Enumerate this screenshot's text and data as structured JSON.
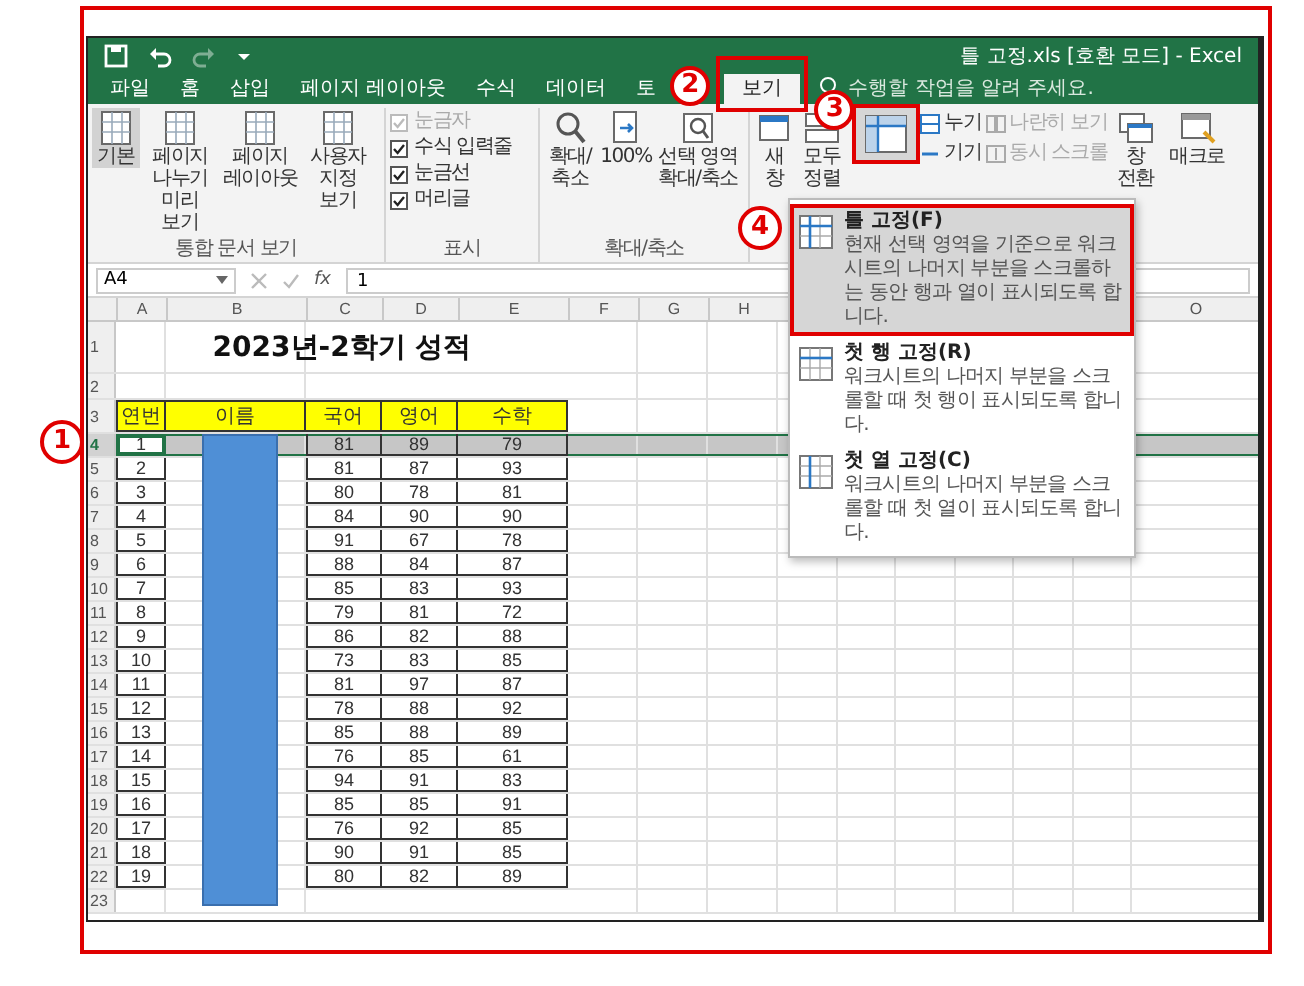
{
  "window": {
    "title": "틀 고정.xls  [호환 모드] - Excel"
  },
  "tabs": [
    {
      "label": "파일",
      "selected": false
    },
    {
      "label": "홈",
      "selected": false
    },
    {
      "label": "삽입",
      "selected": false
    },
    {
      "label": "페이지 레이아웃",
      "selected": false
    },
    {
      "label": "수식",
      "selected": false
    },
    {
      "label": "데이터",
      "selected": false
    },
    {
      "label": "토",
      "selected": false
    },
    {
      "label": "보기",
      "selected": true
    }
  ],
  "tell_me": {
    "placeholder": "수행할 작업을 알려 주세요."
  },
  "ribbon": {
    "workbook_views": {
      "label": "통합 문서 보기",
      "buttons": [
        {
          "label": "기본",
          "selected": true
        },
        {
          "label": "페이지 나누기 미리 보기",
          "selected": false
        },
        {
          "label": "페이지 레이아웃",
          "selected": false
        },
        {
          "label": "사용자 지정 보기",
          "selected": false
        }
      ]
    },
    "show": {
      "label": "표시",
      "options": [
        {
          "label": "눈금자",
          "checked": true,
          "disabled": true
        },
        {
          "label": "수식 입력줄",
          "checked": true,
          "disabled": false
        },
        {
          "label": "눈금선",
          "checked": true,
          "disabled": false
        },
        {
          "label": "머리글",
          "checked": true,
          "disabled": false
        }
      ]
    },
    "zoom": {
      "label": "확대/축소",
      "buttons": [
        "확대/축소",
        "100%",
        "선택 영역 확대/축소"
      ]
    },
    "window": {
      "new_window": "새 창",
      "arrange_all": "모두 정렬",
      "split": "누기",
      "hide": "기기",
      "side_by_side": {
        "label": "나란히 보기",
        "disabled": true
      },
      "sync_scroll": {
        "label": "동시 스크롤",
        "disabled": true
      },
      "switch_windows": "창 전환",
      "macros": "매크로"
    }
  },
  "formula_bar": {
    "name_box": "A4",
    "function_label": "fx",
    "value": "1"
  },
  "sheet": {
    "columns_left": [
      "A",
      "B",
      "C",
      "D",
      "E",
      "F",
      "G",
      "H"
    ],
    "columns_right": [
      "O"
    ],
    "title": {
      "row": "1",
      "text": "2023년-2학기 성적"
    },
    "blank_row": "2",
    "header": {
      "row": "3",
      "cells": [
        "연번",
        "이름",
        "국어",
        "영어",
        "수학"
      ]
    },
    "rows": [
      {
        "row": "4",
        "no": "1",
        "korean": "81",
        "english": "89",
        "math": "79",
        "selected": true
      },
      {
        "row": "5",
        "no": "2",
        "korean": "81",
        "english": "87",
        "math": "93",
        "selected": false
      },
      {
        "row": "6",
        "no": "3",
        "korean": "80",
        "english": "78",
        "math": "81",
        "selected": false
      },
      {
        "row": "7",
        "no": "4",
        "korean": "84",
        "english": "90",
        "math": "90",
        "selected": false
      },
      {
        "row": "8",
        "no": "5",
        "korean": "91",
        "english": "67",
        "math": "78",
        "selected": false
      },
      {
        "row": "9",
        "no": "6",
        "korean": "88",
        "english": "84",
        "math": "87",
        "selected": false
      },
      {
        "row": "10",
        "no": "7",
        "korean": "85",
        "english": "83",
        "math": "93",
        "selected": false
      },
      {
        "row": "11",
        "no": "8",
        "korean": "79",
        "english": "81",
        "math": "72",
        "selected": false
      },
      {
        "row": "12",
        "no": "9",
        "korean": "86",
        "english": "82",
        "math": "88",
        "selected": false
      },
      {
        "row": "13",
        "no": "10",
        "korean": "73",
        "english": "83",
        "math": "85",
        "selected": false
      },
      {
        "row": "14",
        "no": "11",
        "korean": "81",
        "english": "97",
        "math": "87",
        "selected": false
      },
      {
        "row": "15",
        "no": "12",
        "korean": "78",
        "english": "88",
        "math": "92",
        "selected": false
      },
      {
        "row": "16",
        "no": "13",
        "korean": "85",
        "english": "88",
        "math": "89",
        "selected": false
      },
      {
        "row": "17",
        "no": "14",
        "korean": "76",
        "english": "85",
        "math": "61",
        "selected": false
      },
      {
        "row": "18",
        "no": "15",
        "korean": "94",
        "english": "91",
        "math": "83",
        "selected": false
      },
      {
        "row": "19",
        "no": "16",
        "korean": "85",
        "english": "85",
        "math": "91",
        "selected": false
      },
      {
        "row": "20",
        "no": "17",
        "korean": "76",
        "english": "92",
        "math": "85",
        "selected": false
      },
      {
        "row": "21",
        "no": "18",
        "korean": "90",
        "english": "91",
        "math": "85",
        "selected": false
      },
      {
        "row": "22",
        "no": "19",
        "korean": "80",
        "english": "82",
        "math": "89",
        "selected": false
      }
    ],
    "last_row": "23"
  },
  "freeze_menu": {
    "items": [
      {
        "title": "틀 고정(F)",
        "description": "현재 선택 영역을 기준으로 워크시트의 나머지 부분을 스크롤하는 동안 행과 열이 표시되도록 합니다.",
        "selected": true
      },
      {
        "title": "첫 행 고정(R)",
        "description": "워크시트의 나머지 부분을 스크롤할 때 첫 행이 표시되도록 합니다.",
        "selected": false
      },
      {
        "title": "첫 열 고정(C)",
        "description": "워크시트의 나머지 부분을 스크롤할 때 첫 열이 표시되도록 합니다.",
        "selected": false
      }
    ]
  },
  "callouts": [
    "1",
    "2",
    "3",
    "4"
  ]
}
